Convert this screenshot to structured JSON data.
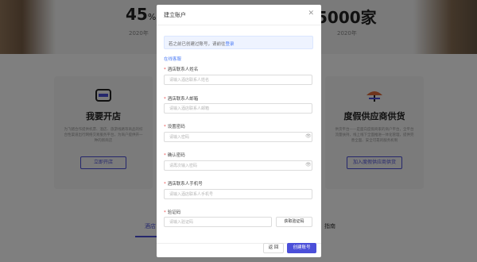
{
  "background": {
    "stats": [
      {
        "value": "45",
        "unit": "%",
        "year": "2020年"
      },
      {
        "value": "超5000家",
        "year": "2020年"
      }
    ],
    "cards": [
      {
        "title": "我要开店",
        "desc": "为飞猪合作提供机票、酒店、旅游线路等商品的综合性渠道出行网络交易服务平台，为商户提供开一种的新商店",
        "button": "立即开店",
        "icon": "shop-icon"
      },
      {
        "title": "度假供应商供货",
        "desc": "供货平台——是面向度假商家的商户平台，全平台流量扶持，线上线下全面推进一体化管理，提供完善全面、安全可靠的服务机制",
        "button": "加入度假供应商供货",
        "icon": "umbrella-icon"
      }
    ],
    "subnav": [
      "酒店",
      "指南"
    ]
  },
  "modal": {
    "title": "建立账户",
    "close_glyph": "✕",
    "notice_prefix": "若之前已创建过账号，请前往",
    "notice_link": "登录",
    "section_link": "在线客服",
    "fields": [
      {
        "label": "酒店联系人姓名",
        "placeholder": "请输入酒店联系人姓名"
      },
      {
        "label": "酒店联系人邮箱",
        "placeholder": "请输入酒店联系人邮箱"
      },
      {
        "label": "设置密码",
        "placeholder": "请输入密码"
      },
      {
        "label": "确认密码",
        "placeholder": "请再次输入密码"
      },
      {
        "label": "酒店联系人手机号",
        "placeholder": "请输入酒店联系人手机号"
      },
      {
        "label": "验证码",
        "placeholder": "请输入验证码"
      }
    ],
    "get_code": "获取验证码",
    "back": "返 回",
    "create": "创建账号",
    "eye_glyph": "👁"
  },
  "colors": {
    "accent": "#4b4fd9",
    "link": "#4b7bf5",
    "required": "#e94b4b"
  }
}
